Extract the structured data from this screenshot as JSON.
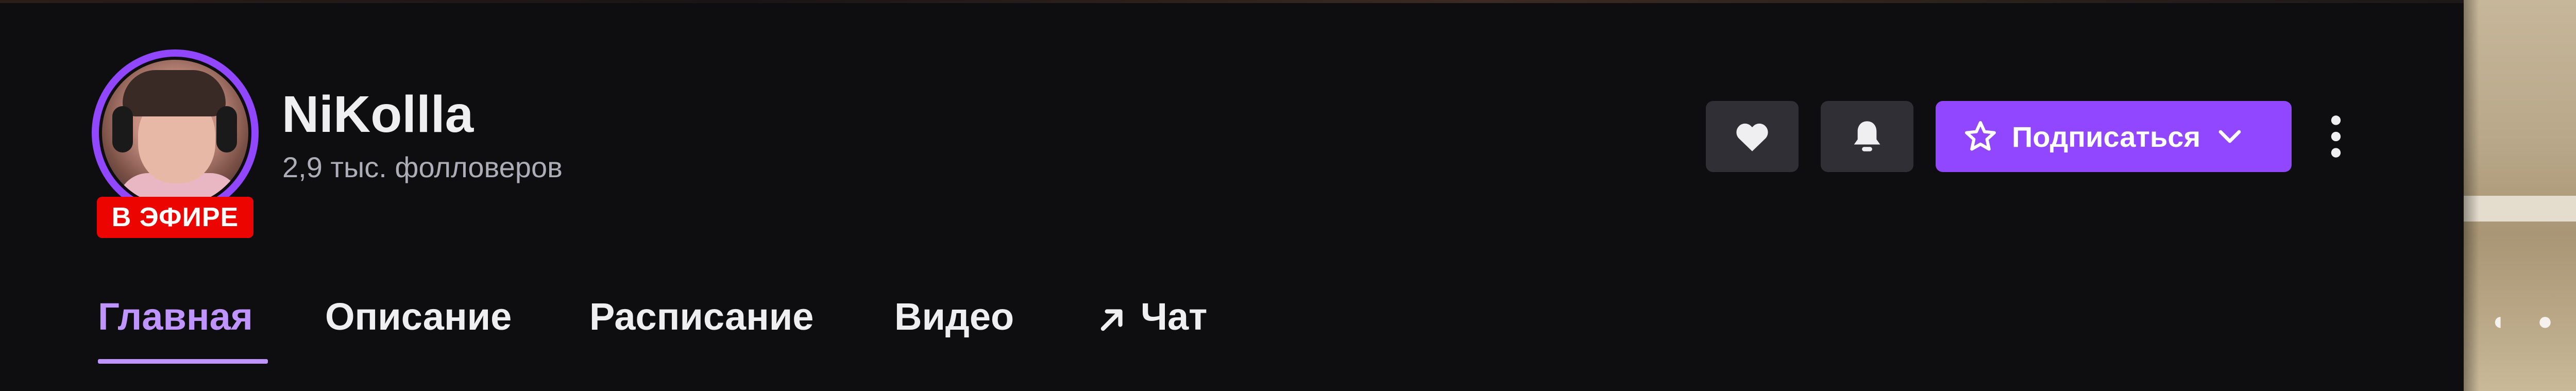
{
  "channel": {
    "name": "NiKollla",
    "followers": "2,9 тыс. фолловеров",
    "live_badge": "В ЭФИРЕ"
  },
  "actions": {
    "follow_icon": "heart-icon",
    "notify_icon": "bell-icon",
    "subscribe_label": "Подписаться",
    "more_icon": "more-vertical-icon"
  },
  "tabs": [
    {
      "label": "Главная",
      "active": true
    },
    {
      "label": "Описание",
      "active": false
    },
    {
      "label": "Расписание",
      "active": false
    },
    {
      "label": "Видео",
      "active": false
    },
    {
      "label": "Чат",
      "active": false,
      "icon": "arrow-up-right-icon"
    }
  ],
  "colors": {
    "background": "#0e0e10",
    "accent": "#9147ff",
    "accent_light": "#bf94ff",
    "live": "#eb0400",
    "button_bg": "#2f2f35",
    "text_primary": "#efeff1",
    "text_secondary": "#adadb8"
  }
}
